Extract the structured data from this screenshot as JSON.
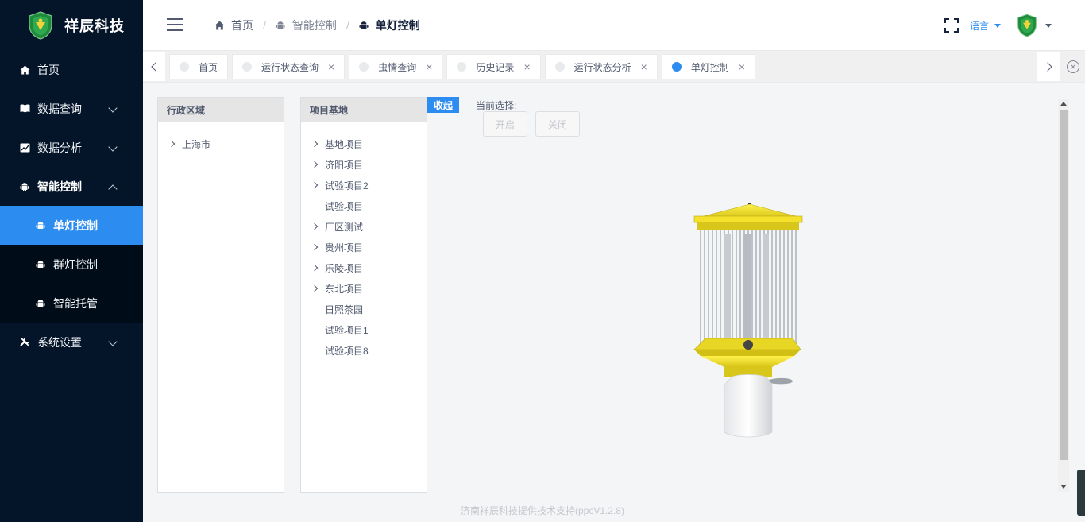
{
  "brand": {
    "name": "祥辰科技",
    "logo_icon": "shield-logo-icon",
    "primary": "#2d8cf0",
    "sidebar_bg": "#04152a"
  },
  "sidebar": {
    "items": [
      {
        "label": "首页",
        "icon": "home-icon"
      },
      {
        "label": "数据查询",
        "icon": "book-icon"
      },
      {
        "label": "数据分析",
        "icon": "chart-icon"
      },
      {
        "label": "智能控制",
        "icon": "android-icon",
        "expanded": true
      },
      {
        "label": "系统设置",
        "icon": "tools-icon"
      }
    ],
    "sub_items": [
      {
        "label": "单灯控制",
        "active": true
      },
      {
        "label": "群灯控制"
      },
      {
        "label": "智能托管"
      }
    ]
  },
  "header": {
    "breadcrumb": [
      "首页",
      "智能控制",
      "单灯控制"
    ],
    "lang_label": "语言"
  },
  "tabs": [
    {
      "label": "首页",
      "closable": false,
      "active": false
    },
    {
      "label": "运行状态查询",
      "closable": true,
      "active": false
    },
    {
      "label": "虫情查询",
      "closable": true,
      "active": false
    },
    {
      "label": "历史记录",
      "closable": true,
      "active": false
    },
    {
      "label": "运行状态分析",
      "closable": true,
      "active": false
    },
    {
      "label": "单灯控制",
      "closable": true,
      "active": true
    }
  ],
  "region_panel": {
    "title": "行政区域",
    "nodes": [
      {
        "label": "上海市",
        "has_children": true
      }
    ]
  },
  "project_panel": {
    "title": "项目基地",
    "nodes": [
      {
        "label": "基地项目",
        "has_children": true
      },
      {
        "label": "济阳项目",
        "has_children": true
      },
      {
        "label": "试验项目2",
        "has_children": true
      },
      {
        "label": "试验项目",
        "has_children": false
      },
      {
        "label": "厂区测试",
        "has_children": true
      },
      {
        "label": "贵州项目",
        "has_children": true
      },
      {
        "label": "乐陵项目",
        "has_children": true
      },
      {
        "label": "东北项目",
        "has_children": true
      },
      {
        "label": "日照茶园",
        "has_children": false
      },
      {
        "label": "试验项目1",
        "has_children": false
      },
      {
        "label": "试验项目8",
        "has_children": false
      }
    ]
  },
  "control": {
    "collapse_label": "收起",
    "current_selection_label": "当前选择:",
    "open_label": "开启",
    "close_label": "关闭"
  },
  "footer": {
    "text": "济南祥辰科技提供技术支持(ppcV1.2.8)"
  }
}
